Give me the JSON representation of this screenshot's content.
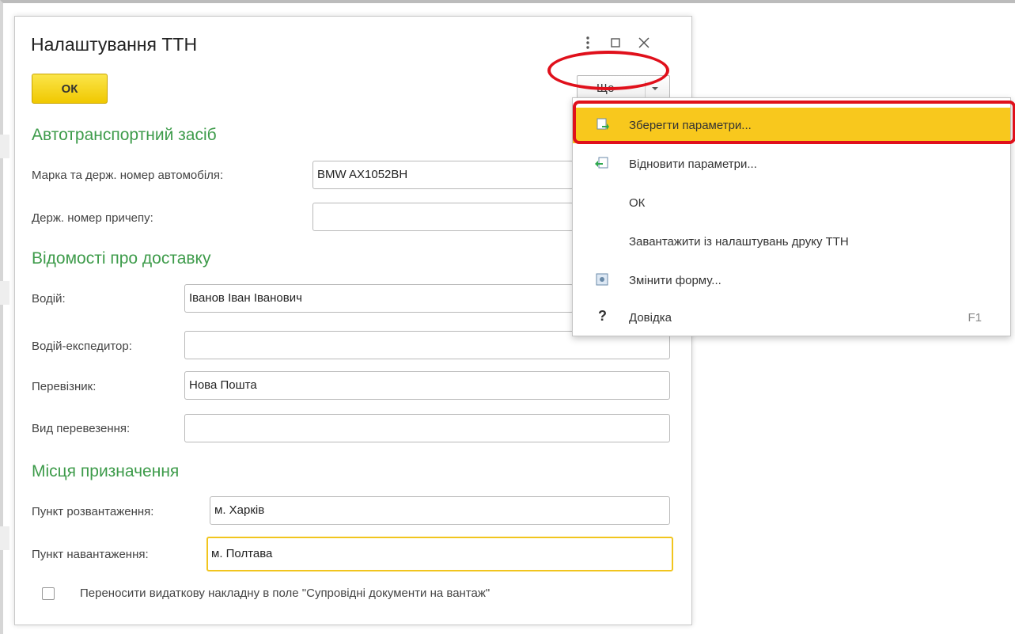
{
  "dialog": {
    "title": "Налаштування ТТН",
    "ok_label": "ОК",
    "more_label": "Ще"
  },
  "sections": {
    "vehicle": "Автотранспортний засіб",
    "delivery": "Відомості про доставку",
    "destination": "Місця призначення"
  },
  "fields": {
    "car_label": "Марка та держ. номер автомобіля:",
    "car_value": "BMW AX1052BH",
    "trailer_label": "Держ. номер причепу:",
    "trailer_value": "",
    "driver_label": "Водій:",
    "driver_value": "Іванов Іван Іванович",
    "forwarder_label": "Водій-експедитор:",
    "forwarder_value": "",
    "carrier_label": "Перевізник:",
    "carrier_value": "Нова Пошта",
    "transport_type_label": "Вид перевезення:",
    "transport_type_value": "",
    "unload_label": "Пункт розвантаження:",
    "unload_value": "м. Харків",
    "load_label": "Пункт навантаження:",
    "load_value": "м. Полтава",
    "checkbox_label": "Переносити видаткову накладну в поле \"Супровідні документи на вантаж\""
  },
  "menu": {
    "items": [
      {
        "label": "Зберегти параметри...",
        "icon": "save-settings-icon",
        "key": ""
      },
      {
        "label": "Відновити параметри...",
        "icon": "restore-settings-icon",
        "key": ""
      },
      {
        "label": "ОК",
        "icon": "",
        "key": ""
      },
      {
        "label": "Завантажити із налаштувань друку ТТН",
        "icon": "",
        "key": ""
      },
      {
        "label": "Змінити форму...",
        "icon": "change-form-icon",
        "key": ""
      },
      {
        "label": "Довідка",
        "icon": "help-icon",
        "key": "F1"
      }
    ]
  },
  "colors": {
    "accent_green": "#3d9b4a",
    "highlight_yellow": "#f8c81d",
    "annotation_red": "#e0101b"
  }
}
